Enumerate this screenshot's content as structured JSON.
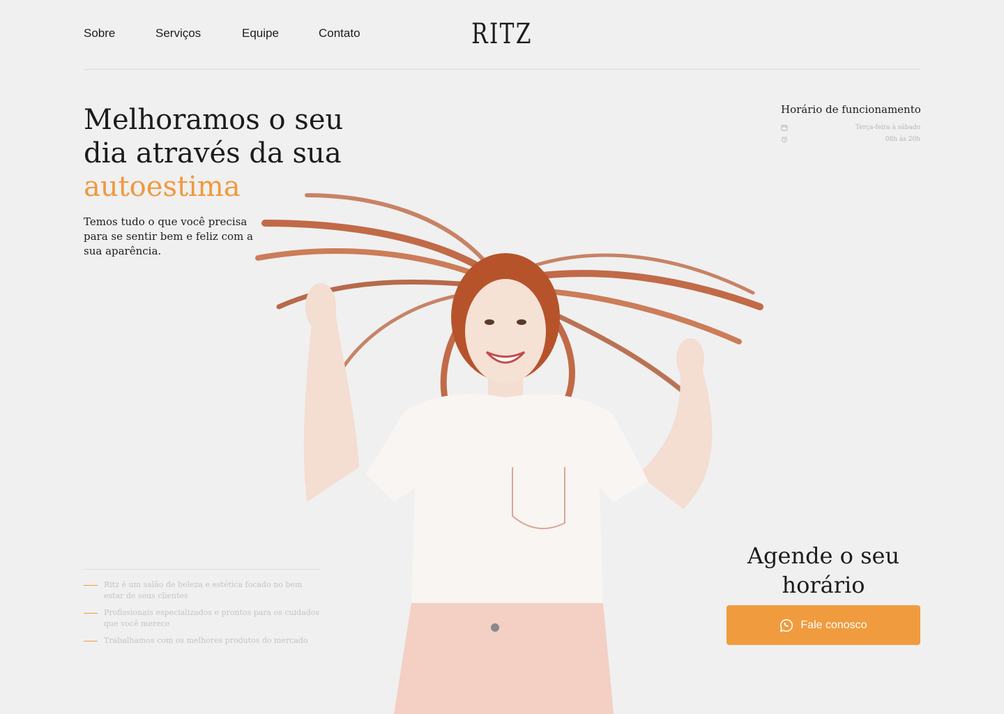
{
  "nav": {
    "items": [
      {
        "label": "Sobre"
      },
      {
        "label": "Serviços"
      },
      {
        "label": "Equipe"
      },
      {
        "label": "Contato"
      }
    ]
  },
  "brand": {
    "logo": "RITZ"
  },
  "hero": {
    "title_line1": "Melhoramos o seu",
    "title_line2": "dia através da sua",
    "title_accent": "autoestima",
    "subtitle": "Temos tudo o que você precisa para se sentir bem e feliz com a sua aparência."
  },
  "hours": {
    "title": "Horário de funcionamento",
    "days": "Terça-feira à sábado",
    "time": "08h às 20h",
    "days_icon": "calendar-icon",
    "time_icon": "alarm-clock-icon"
  },
  "features": [
    {
      "text": "Ritz é um salão de beleza e estética focado no bem estar de seus clientes"
    },
    {
      "text": "Profissionais especializados e prontos para os cuidados que você merece"
    },
    {
      "text": "Trabalhamos com os melhores produtos do mercado"
    }
  ],
  "cta": {
    "title": "Agende o seu horário",
    "button_label": "Fale conosco",
    "button_icon": "whatsapp-icon"
  },
  "colors": {
    "accent": "#f0993d",
    "background": "#f0f0f0",
    "text": "#1c1c1c"
  }
}
